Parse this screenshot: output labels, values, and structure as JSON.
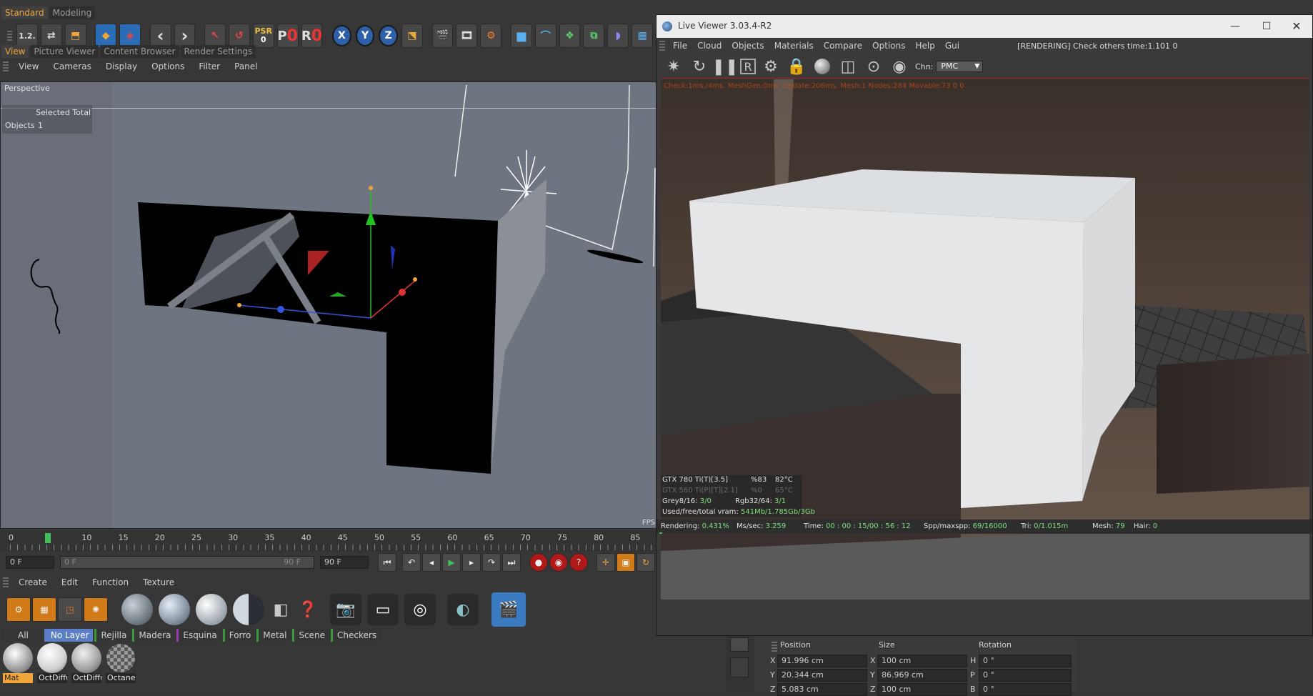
{
  "layout_tabs": [
    {
      "label": "Standard",
      "active": true
    },
    {
      "label": "Modeling",
      "active": false
    }
  ],
  "toolbar": {
    "undo_label": "1.2.",
    "psr_label": "PSR",
    "psr_value": "0",
    "p_label": "P",
    "p_value": "0",
    "r_label": "R",
    "r_value": "0",
    "axes": [
      "X",
      "Y",
      "Z"
    ]
  },
  "view_tabs": [
    {
      "label": "View",
      "active": true
    },
    {
      "label": "Picture Viewer",
      "active": false
    },
    {
      "label": "Content Browser",
      "active": false
    },
    {
      "label": "Render Settings",
      "active": false
    }
  ],
  "viewport_menu": [
    "View",
    "Cameras",
    "Display",
    "Options",
    "Filter",
    "Panel"
  ],
  "viewport": {
    "title": "Perspective",
    "stats_header": "Selected Total",
    "stats_label": "Objects",
    "stats_value": "1",
    "fps_label": "FPS"
  },
  "timeline": {
    "ticks": [
      "0",
      "5",
      "10",
      "15",
      "20",
      "25",
      "30",
      "35",
      "40",
      "45",
      "50",
      "55",
      "60",
      "65",
      "70",
      "75",
      "80",
      "85"
    ],
    "current_frame": 5,
    "start_frame": "0 F",
    "range_start": "0 F",
    "range_end": "90 F",
    "end_frame": "90 F"
  },
  "material_menu": [
    "Create",
    "Edit",
    "Function",
    "Texture"
  ],
  "layer_tabs": [
    {
      "label": "All",
      "color": ""
    },
    {
      "label": "No Layer",
      "color": "#5a7fc8",
      "active": true
    },
    {
      "label": "Rejilla",
      "color": "#3a9a3a"
    },
    {
      "label": "Madera",
      "color": "#3a9a3a"
    },
    {
      "label": "Esquina",
      "color": "#9a3ab0"
    },
    {
      "label": "Forro",
      "color": "#3a9a3a"
    },
    {
      "label": "Metal",
      "color": "#3a9a3a"
    },
    {
      "label": "Scene",
      "color": "#3a9a3a"
    },
    {
      "label": "Checkers",
      "color": "#3a9a3a"
    }
  ],
  "materials": [
    {
      "label": "Mat",
      "selected": true
    },
    {
      "label": "OctDiffu"
    },
    {
      "label": "OctDiffu"
    },
    {
      "label": "Octane"
    }
  ],
  "live_viewer": {
    "title": "Live Viewer 3.03.4-R2",
    "menu": [
      "File",
      "Cloud",
      "Objects",
      "Materials",
      "Compare",
      "Options",
      "Help",
      "Gui"
    ],
    "status": "[RENDERING] Check others time:1.101  0",
    "chn_label": "Chn:",
    "chn_value": "PMC",
    "info_line": "Check:1ms./4ms. MeshGen:0ms. Update:206ms. Mesh:1 Nodes:284 Movable:73  0 0",
    "gpu": [
      {
        "name": "GTX 780 Ti(T)[3.5]",
        "usage": "%83",
        "temp": "82°C"
      },
      {
        "name": "GTX 560 Ti(P)[T][2.1]",
        "usage": "%0",
        "temp": "65°C"
      }
    ],
    "grey_label": "Grey8/16:",
    "grey_value": "3/0",
    "rgb_label": "Rgb32/64:",
    "rgb_value": "3/1",
    "vram_label": "Used/free/total vram:",
    "vram_value": "541Mb/1.785Gb/3Gb",
    "rendering_label": "Rendering:",
    "rendering_value": "0.431%",
    "mssec_label": "Ms/sec:",
    "mssec_value": "3.259",
    "time_label": "Time:",
    "time_value": "00 : 00 : 15/00 : 56 : 12",
    "spp_label": "Spp/maxspp:",
    "spp_value": "69/16000",
    "tri_label": "Tri:",
    "tri_value": "0/1.015m",
    "mesh_label": "Mesh:",
    "mesh_value": "79",
    "hair_label": "Hair:",
    "hair_value": "0"
  },
  "coordinates": {
    "headers": [
      "Position",
      "Size",
      "Rotation"
    ],
    "rows": [
      {
        "axis": "X",
        "pos": "91.996 cm",
        "size_axis": "X",
        "size": "100 cm",
        "rot_axis": "H",
        "rot": "0 °"
      },
      {
        "axis": "Y",
        "pos": "20.344 cm",
        "size_axis": "Y",
        "size": "86.969 cm",
        "rot_axis": "P",
        "rot": "0 °"
      },
      {
        "axis": "Z",
        "pos": "5.083 cm",
        "size_axis": "Z",
        "size": "100 cm",
        "rot_axis": "B",
        "rot": "0 °"
      }
    ]
  },
  "colors": {
    "accent_orange": "#f0a53a",
    "axis_blue": "#2e5fa8",
    "render_red": "#b01919",
    "stat_green": "#7ee07e"
  }
}
